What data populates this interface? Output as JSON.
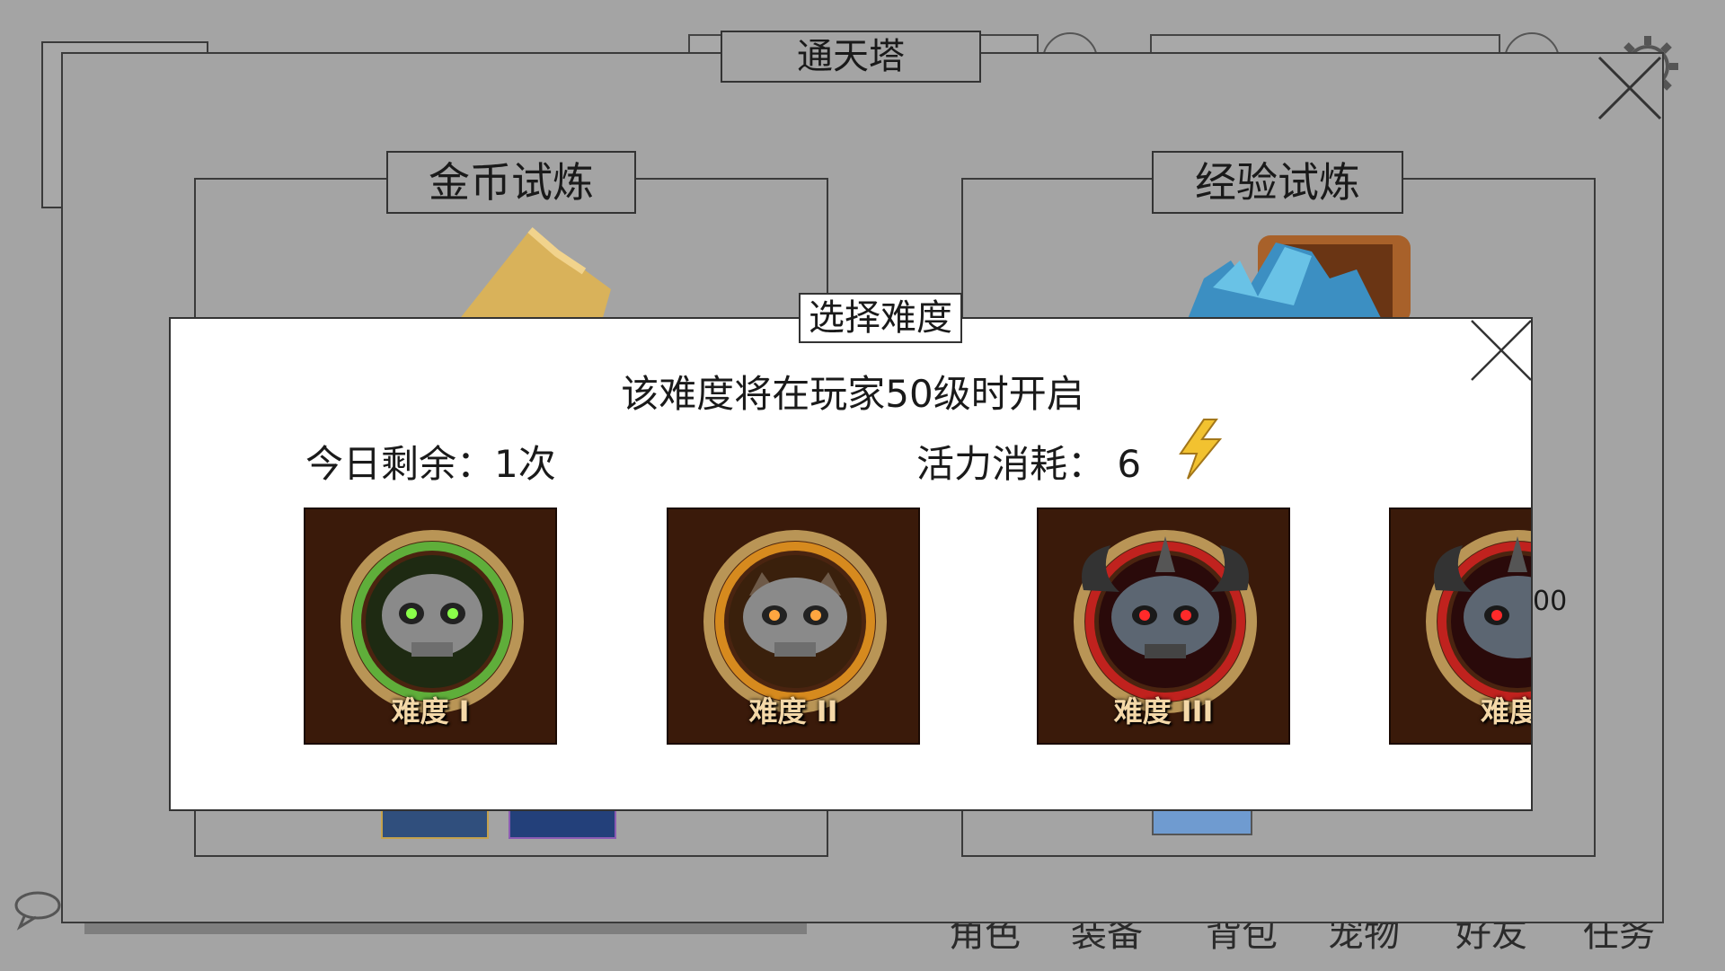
{
  "window": {
    "title": "通天塔"
  },
  "trials": [
    {
      "title": "金币试炼"
    },
    {
      "title": "经验试炼"
    }
  ],
  "background": {
    "partial_value": "00",
    "bottom_tabs": [
      "角色",
      "装备",
      "背包",
      "宠物",
      "好友",
      "任务"
    ]
  },
  "dialog": {
    "title": "选择难度",
    "notice": "该难度将在玩家50级时开启",
    "remaining_label": "今日剩余：",
    "remaining_value": "1次",
    "energy_label": "活力消耗：",
    "energy_value": "6",
    "difficulties": [
      {
        "label": "难度 I",
        "ring_color": "#5fae3a",
        "eye_color": "#8aff4a"
      },
      {
        "label": "难度 II",
        "ring_color": "#d68a1e",
        "eye_color": "#ffa640"
      },
      {
        "label": "难度 III",
        "ring_color": "#c0221e",
        "eye_color": "#ff2a2a"
      },
      {
        "label": "难度",
        "ring_color": "#c0221e",
        "eye_color": "#ff2a2a"
      }
    ]
  },
  "icons": [
    "settings-gear-icon",
    "close-icon",
    "lightning-energy-icon",
    "chat-bubble-icon"
  ]
}
